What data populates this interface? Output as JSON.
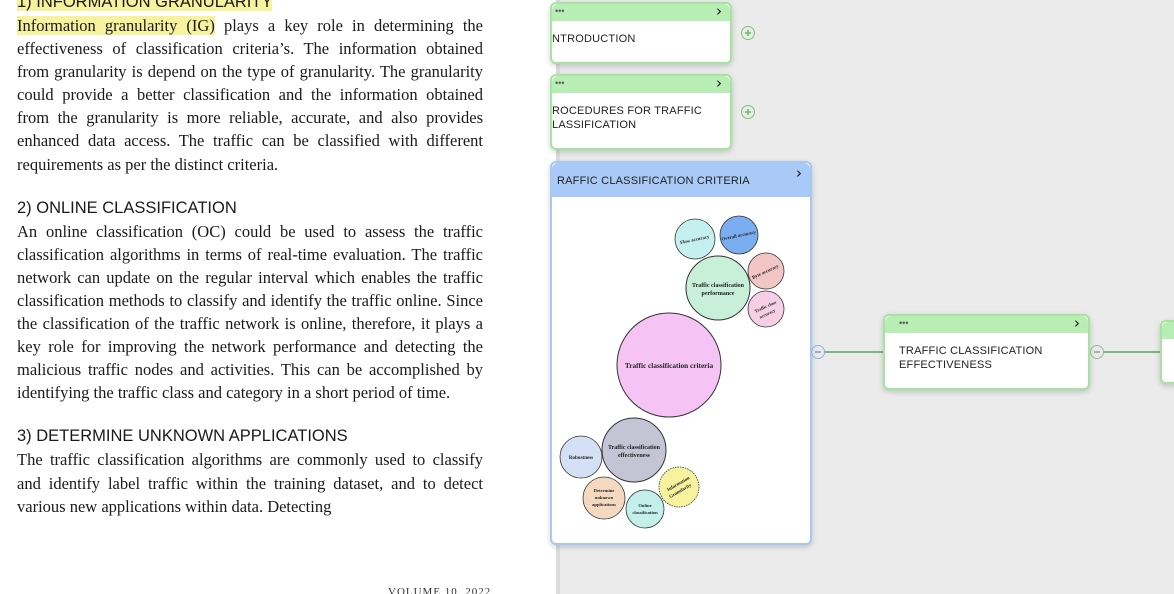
{
  "document": {
    "top_partial_heading": "1) INFORMATION GRANULARITY",
    "para1_highlight": "Information granularity (IG)",
    "para1_rest": " plays a key role in determining the effectiveness of classification criteria’s. The information obtained from granularity is depend on the type of granularity. The granularity could provide a better classification and the information obtained from the granularity is more reliable, accurate, and also provides enhanced data access. The traffic can be classified with different requirements as per the distinct criteria.",
    "heading2": "2) ONLINE CLASSIFICATION",
    "para2": "An online classification (OC) could be used to assess the traffic classification algorithms in terms of real-time evaluation. The traffic network can update on the regular interval which enables the traffic classification methods to classify and identify the traffic online. Since the classification of the traffic network is online, therefore, it plays a key role for improving the network performance and detecting the malicious traffic nodes and activities. This can be accomplished by identifying the traffic class and category in a short period of time.",
    "heading3": "3) DETERMINE UNKNOWN APPLICATIONS",
    "para3": "The traffic classification algorithms are commonly used to classify and identify label traffic within the training dataset, and to detect various new applications within data. Detecting",
    "footer_partial": "VOLUME 10, 2022"
  },
  "canvas": {
    "node_introduction": {
      "label": "NTRODUCTION",
      "menu_dots": "•••",
      "chevron": "›"
    },
    "node_procedures": {
      "label_line1": "ROCEDURES FOR TRAFFIC",
      "label_line2": "LASSIFICATION",
      "menu_dots": "•••",
      "chevron": "›"
    },
    "node_criteria": {
      "label": "RAFFIC CLASSIFICATION CRITERIA",
      "chevron": "›"
    },
    "node_effectiveness": {
      "label_line1": "TRAFFIC CLASSIFICATION",
      "label_line2": "EFFECTIVENESS",
      "menu_dots": "•••",
      "chevron": "›"
    },
    "icons": {
      "expand": "plus-circle-icon",
      "collapse": "minus-circle-icon",
      "more": "more-dots-icon",
      "open": "chevron-right-icon"
    },
    "colors": {
      "green_bar": "#b8eeb3",
      "blue_bar": "#a9c9f6",
      "connector": "#7fb57f"
    }
  },
  "bubble_diagram": {
    "root": {
      "label": "Traffic classification criteria",
      "color": "#f6c4f4"
    },
    "performance": {
      "line1": "Traffic classification",
      "line2": "performance",
      "color": "#c8f0d8"
    },
    "effectiveness": {
      "line1": "Traffic classification",
      "line2": "effectiveness",
      "color": "#c4c4d4"
    },
    "flow_accuracy": {
      "label": "Flow accuracy",
      "color": "#c4f1f0"
    },
    "overall_accuracy": {
      "label": "Overall accuracy",
      "color": "#7aaef0"
    },
    "byte_accuracy": {
      "label": "Byte accuracy",
      "color": "#f3c6c6"
    },
    "class_accuracy": {
      "line1": "Traffic class",
      "line2": "accuracy",
      "color": "#f6cfe6"
    },
    "robustness": {
      "label": "Robustness",
      "color": "#d4e0f4"
    },
    "unknown_apps": {
      "line1": "Determine",
      "line2": "unknown",
      "line3": "applications",
      "color": "#f4d8c0"
    },
    "online_classification": {
      "line1": "Online",
      "line2": "classification",
      "color": "#c4f0ec"
    },
    "information_granularity": {
      "line1": "Information",
      "line2": "Granularity",
      "color": "#f6f29e"
    }
  }
}
